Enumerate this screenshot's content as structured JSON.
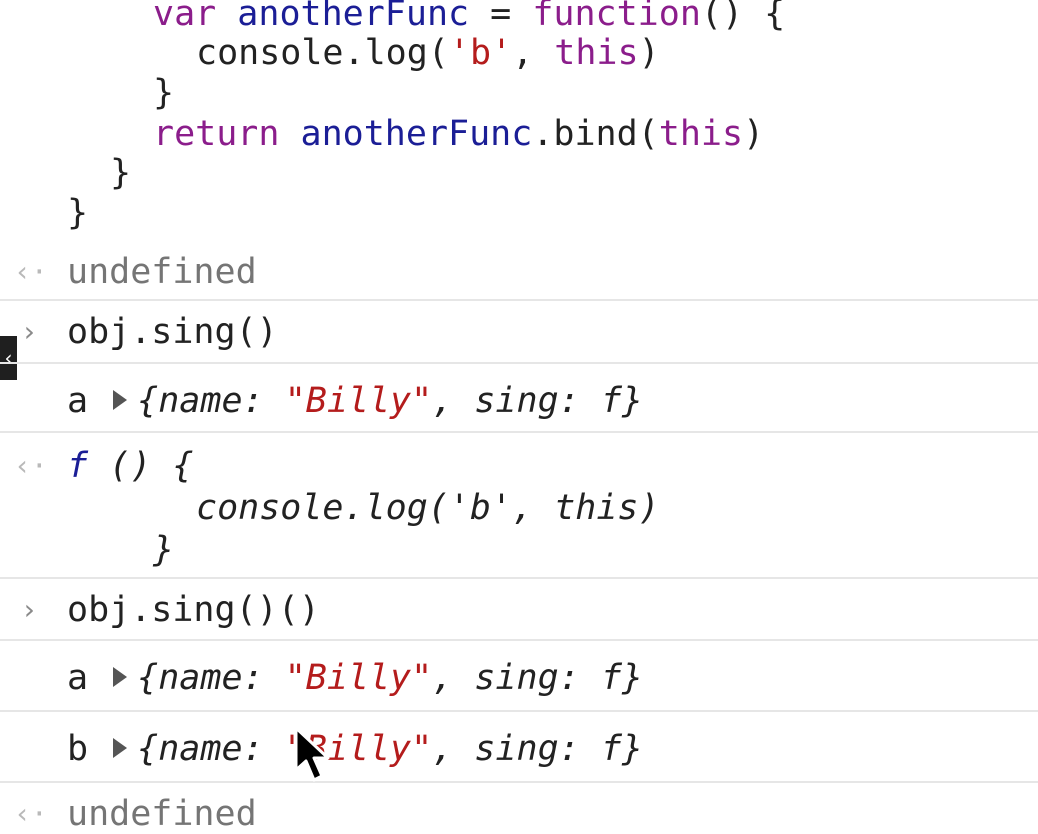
{
  "code_block": {
    "line1": {
      "kw": "var",
      "name": "anotherFunc",
      "op": " = ",
      "kw2": "function",
      "rest": "() {"
    },
    "line2": {
      "pre": "console.log(",
      "str": "'b'",
      "mid": ", ",
      "kw": "this",
      "post": ")"
    },
    "line3": "}",
    "line4": {
      "kw": "return",
      "name": "anotherFunc",
      "mid": ".bind(",
      "kw2": "this",
      "post": ")"
    },
    "line5": "}",
    "line6": "}"
  },
  "result1": {
    "text": "undefined"
  },
  "input1": {
    "text": "obj.sing()"
  },
  "log1": {
    "label": "a",
    "open": "{",
    "key1": "name",
    "colon1": ": ",
    "val1": "\"Billy\"",
    "sep": ", ",
    "key2": "sing",
    "colon2": ": ",
    "val2": "f",
    "close": "}"
  },
  "result2": {
    "f": "f",
    "sig": " () {",
    "body": "console.log('b', this)",
    "close": "}"
  },
  "input2": {
    "text": "obj.sing()()"
  },
  "log2": {
    "label": "a",
    "open": "{",
    "key1": "name",
    "colon1": ": ",
    "val1": "\"Billy\"",
    "sep": ", ",
    "key2": "sing",
    "colon2": ": ",
    "val2": "f",
    "close": "}"
  },
  "log3": {
    "label": "b",
    "open": "{",
    "key1": "name",
    "colon1": ": ",
    "val1": "\"Billy\"",
    "sep": ", ",
    "key2": "sing",
    "colon2": ": ",
    "val2": "f",
    "close": "}"
  },
  "result3": {
    "text": "undefined"
  },
  "icons": {
    "output_marker": "arrow-left-icon",
    "input_prompt": "chevron-right-icon",
    "expand": "triangle-right-icon",
    "sidebar_toggle": "chevron-left-icon",
    "cursor": "mouse-pointer-icon"
  },
  "colors": {
    "keyword": "#8b1d8b",
    "identifier": "#1b1e96",
    "string": "#b41c1c",
    "result_text": "#757575"
  }
}
